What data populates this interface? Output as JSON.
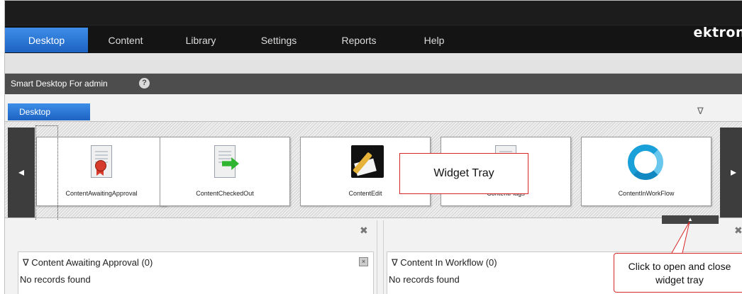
{
  "brand": {
    "logo": "ektron"
  },
  "nav": {
    "tabs": [
      {
        "label": "Desktop",
        "active": true
      },
      {
        "label": "Content",
        "active": false
      },
      {
        "label": "Library",
        "active": false
      },
      {
        "label": "Settings",
        "active": false
      },
      {
        "label": "Reports",
        "active": false
      },
      {
        "label": "Help",
        "active": false
      }
    ]
  },
  "smart_desktop": {
    "title": "Smart Desktop For admin",
    "help_icon": "question-circle-icon"
  },
  "desktop_tab": {
    "label": "Desktop"
  },
  "menu_arrow": {
    "icon": "triangle-down-icon",
    "glyph": "∇"
  },
  "tray": {
    "left_arrow": "◂",
    "right_arrow": "▸",
    "toggle_glyph": "▲",
    "widgets": [
      {
        "label": "ContentAwaitingApproval",
        "icon": "award-ribbon-document-icon"
      },
      {
        "label": "ContentCheckedOut",
        "icon": "document-green-arrow-icon"
      },
      {
        "label": "ContentEdit",
        "icon": "pen-edit-icon"
      },
      {
        "label": "ContentFlags",
        "icon": "document-icon"
      },
      {
        "label": "ContentInWorkFlow",
        "icon": "workflow-cycle-icon"
      }
    ]
  },
  "callouts": {
    "widget_tray": "Widget Tray",
    "toggle_line1": "Click to open and close",
    "toggle_line2": "widget tray"
  },
  "panels": [
    {
      "title": "∇ Content Awaiting Approval (0)",
      "empty": "No records found",
      "close": "×"
    },
    {
      "title": "∇ Content In Workflow (0)",
      "empty": "No records found"
    }
  ],
  "column_remove": "✖",
  "colors": {
    "accent": "#1d62c1",
    "callout_border": "#d72626",
    "topbar": "#141414"
  }
}
